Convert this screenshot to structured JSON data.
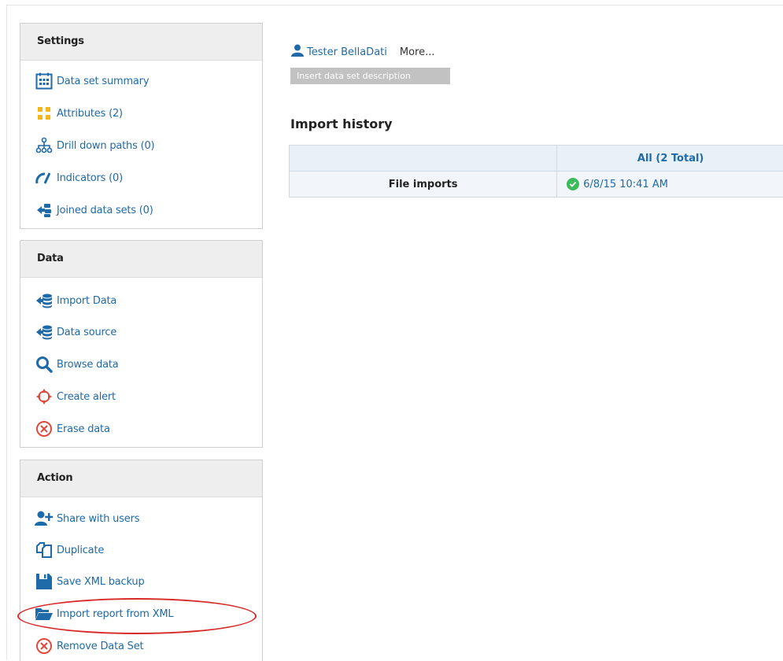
{
  "sidebar": {
    "settings": {
      "title": "Settings",
      "items": [
        {
          "label": "Data set summary",
          "icon": "calendar-icon"
        },
        {
          "label": "Attributes (2)",
          "icon": "dots-icon"
        },
        {
          "label": "Drill down paths (0)",
          "icon": "hierarchy-icon"
        },
        {
          "label": "Indicators (0)",
          "icon": "gauge-icon"
        },
        {
          "label": "Joined data sets (0)",
          "icon": "joined-icon"
        }
      ]
    },
    "data": {
      "title": "Data",
      "items": [
        {
          "label": "Import Data",
          "icon": "database-import-icon"
        },
        {
          "label": "Data source",
          "icon": "database-source-icon"
        },
        {
          "label": "Browse data",
          "icon": "search-icon"
        },
        {
          "label": "Create alert",
          "icon": "alert-icon"
        },
        {
          "label": "Erase data",
          "icon": "erase-icon"
        }
      ]
    },
    "action": {
      "title": "Action",
      "items": [
        {
          "label": "Share with users",
          "icon": "add-user-icon"
        },
        {
          "label": "Duplicate",
          "icon": "duplicate-icon"
        },
        {
          "label": "Save XML backup",
          "icon": "save-icon"
        },
        {
          "label": "Import report from XML",
          "icon": "folder-icon"
        },
        {
          "label": "Remove Data Set",
          "icon": "remove-icon"
        }
      ]
    }
  },
  "main": {
    "user_name": "Tester BellaDati",
    "more_label": "More...",
    "description_button": "Insert data set description",
    "import_history": {
      "title": "Import history",
      "column_header": "All (2 Total)",
      "rows": [
        {
          "label": "File imports",
          "value": "6/8/15 10:41 AM"
        }
      ]
    }
  },
  "colors": {
    "link": "#1f6aa8",
    "success": "#3dbb5b",
    "highlight": "#d82828"
  }
}
